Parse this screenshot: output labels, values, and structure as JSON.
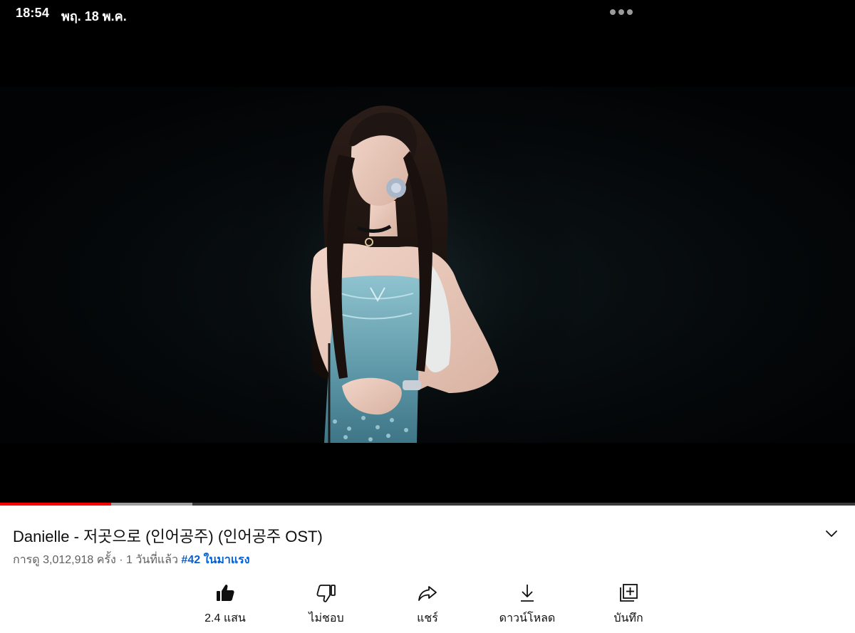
{
  "status_bar": {
    "time": "18:54",
    "date": "พฤ. 18 พ.ค."
  },
  "player": {
    "progress_played_fraction": 0.13,
    "progress_buffered_fraction": 0.225,
    "progress_color": "#ff0000"
  },
  "video": {
    "title": "Danielle - 저곳으로 (인어공주) (인어공주 OST)",
    "views_text": "การดู 3,012,918 ครั้ง · 1 วันที่แล้ว",
    "trending_text": "#42 ในมาแรง",
    "trending_color": "#065fd4"
  },
  "actions": {
    "like_label": "2.4 แสน",
    "dislike_label": "ไม่ชอบ",
    "share_label": "แชร์",
    "download_label": "ดาวน์โหลด",
    "save_label": "บันทึก"
  },
  "icons": {
    "expand": "chevron-down-icon",
    "like": "thumbs-up-icon",
    "dislike": "thumbs-down-icon",
    "share": "share-arrow-icon",
    "download": "download-icon",
    "save": "add-to-playlist-icon",
    "more": "more-dots-icon"
  }
}
